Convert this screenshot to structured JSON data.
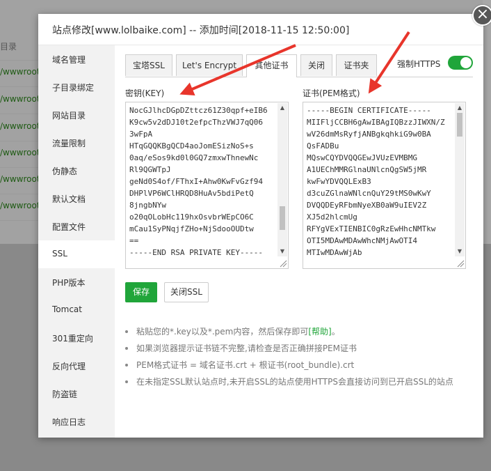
{
  "background": {
    "header": "目录",
    "rows": [
      "/wwwroot",
      "/wwwroot",
      "/wwwroot",
      "/wwwroot",
      "/wwwroot",
      "/wwwroot",
      "/wwwroot"
    ]
  },
  "modal": {
    "title": "站点修改[www.lolbaike.com] -- 添加时间[2018-11-15 12:50:00]",
    "close_glyph": "×"
  },
  "sidebar": {
    "items": [
      {
        "label": "域名管理"
      },
      {
        "label": "子目录绑定"
      },
      {
        "label": "网站目录"
      },
      {
        "label": "流量限制"
      },
      {
        "label": "伪静态"
      },
      {
        "label": "默认文档"
      },
      {
        "label": "配置文件"
      },
      {
        "label": "SSL"
      },
      {
        "label": "PHP版本"
      },
      {
        "label": "Tomcat"
      },
      {
        "label": "301重定向"
      },
      {
        "label": "反向代理"
      },
      {
        "label": "防盗链"
      },
      {
        "label": "响应日志"
      }
    ],
    "active_index": 7
  },
  "tabs": [
    {
      "label": "宝塔SSL"
    },
    {
      "label": "Let's Encrypt"
    },
    {
      "label": "其他证书"
    },
    {
      "label": "关闭"
    },
    {
      "label": "证书夹"
    }
  ],
  "active_tab": 2,
  "force_https": {
    "label": "强制HTTPS",
    "enabled": true
  },
  "key_field": {
    "label": "密钥(KEY)",
    "value": "NocGJlhcDGpDZttcz61Z30qpf+eIB6\nK9cw5v2dDJ10t2efpcThzVWJ7qQ06\n3wFpA\nHTqGQQKBgQCD4aoJomESizNoS+s\n0aq/eSos9kd0l0GQ7zmxwThnewNc\nRl9QGWTpJ\ngeNd0S4of/FThxI+Ahw0KwFvGzf94\nDHPlVP6WClHRQD8HuAv5bdiPetQ\n8jngbNYw\no20qOLobHc119hxOsvbrWEpCO6C\nmCau1SyPNqjfZHo+NjSdooOUDtw\n==\n-----END RSA PRIVATE KEY-----",
    "scroll_position": 0.85
  },
  "cert_field": {
    "label": "证书(PEM格式)",
    "value": "-----BEGIN CERTIFICATE-----\nMIIFljCCBH6gAwIBAgIQBzzJIWXN/Z\nwV26dmMsRyfjANBgkqhkiG9w0BA\nQsFADBu\nMQswCQYDVQQGEwJVUzEVMBMG\nA1UEChMMRGlnaUNlcnQgSW5jMR\nkwFwYDVQQLExB3\nd3cuZGlnaWNlcnQuY29tMS0wKwY\nDVQQDEyRFbmNyeXB0aW9uIEV2Z\nXJ5d2hlcmUg\nRFYgVExTIENBIC0gRzEwHhcNMTkw\nOTI5MDAwMDAwWhcNMjAwOTI4\nMTIwMDAwWjAb",
    "scroll_position": 0.0
  },
  "buttons": {
    "save": "保存",
    "close_ssl": "关闭SSL"
  },
  "tips": {
    "tip1_text": "粘贴您的*.key以及*.pem内容，然后保存即可",
    "tip1_link": "[帮助]",
    "tip1_end": "。",
    "tip2": "如果浏览器提示证书链不完整,请检查是否正确拼接PEM证书",
    "tip3": "PEM格式证书 = 域名证书.crt + 根证书(root_bundle).crt",
    "tip4": "在未指定SSL默认站点时,未开启SSL的站点使用HTTPS会直接访问到已开启SSL的站点"
  },
  "colors": {
    "accent": "#20a53a",
    "arrow": "#e8352b",
    "link": "#20a53a"
  },
  "icons": {
    "scroll_up": "▲",
    "scroll_down": "▼",
    "close": "×"
  }
}
